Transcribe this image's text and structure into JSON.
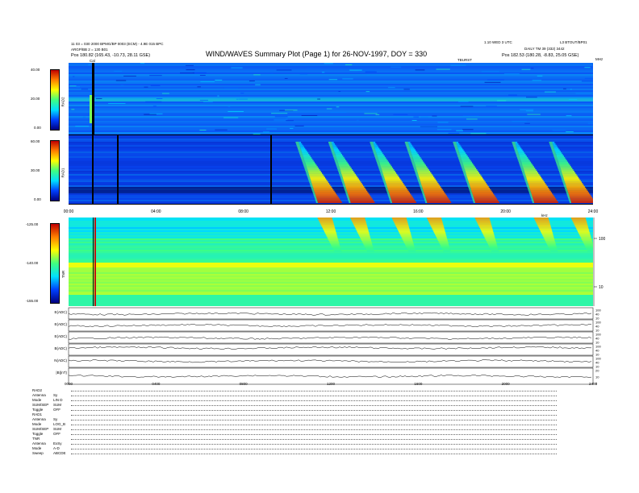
{
  "header": {
    "left_line1": "11 03 = 030 2000 BPMG/BP 0003 (ECM) - 4.9E 015 BPC",
    "left_line2": "ARGP/BB 2 = 130 B01",
    "left_pos": "Pos    180.82 (165.43, -10.73, 28.11 GSE)",
    "title": "WIND/WAVES Summary Plot (Page 1) for 26-NOV-1997, DOY = 330",
    "right_line1": "1.10 WED 3 UTC",
    "right_line2": "L3 BTOUT/BP01",
    "right_line3": "DAILY  TM 39 (332) 3442",
    "right_pos": "Pos    182.53 (180.28, -8.83, 25.05 GSE)",
    "top_right_tag": "TBURST",
    "cal_label": "Cal",
    "mhz_label": "MHz",
    "khz_label": "kHz"
  },
  "chart_data": [
    {
      "type": "heatmap",
      "panel": "RAD2",
      "ylabel": "RAD2",
      "colorbar_ticks": [
        "40.00",
        "20.00",
        "0.00"
      ],
      "colorbar_range": [
        0,
        40
      ],
      "colormap": [
        "#000080",
        "#0040ff",
        "#00e0ff",
        "#40ff80",
        "#ffff00",
        "#ff8000",
        "#c00000"
      ],
      "dominant_color": "#1050e8",
      "x_range_hours": [
        0,
        24
      ]
    },
    {
      "type": "heatmap",
      "panel": "RAD1",
      "ylabel": "RAD1",
      "colorbar_ticks": [
        "60.00",
        "30.00",
        "0.00"
      ],
      "colorbar_range": [
        0,
        60
      ],
      "x_ticks": [
        "00:00",
        "04:00",
        "08:00",
        "12:00",
        "16:00",
        "20:00",
        "24:00"
      ],
      "burst_start_hours": [
        11.4,
        12.9,
        14.8,
        16.4,
        18.6,
        21.3,
        23.0
      ],
      "dominant_color": "#1040e0",
      "x_range_hours": [
        0,
        24
      ]
    },
    {
      "type": "heatmap",
      "panel": "TNR",
      "ylabel": "TNR",
      "colorbar_ticks": [
        "-125.00",
        "-140.00",
        "-155.00"
      ],
      "colorbar_range": [
        -155,
        -125
      ],
      "right_axis_ticks": [
        "100",
        "10"
      ],
      "right_axis_scale": "log",
      "x_range_hours": [
        0,
        24
      ]
    },
    {
      "type": "line",
      "panel": "lines",
      "series": [
        {
          "name": "E(ADC)",
          "right_ticks": [
            "100",
            "40",
            "10"
          ],
          "level": 0.55
        },
        {
          "name": "E(ADC)",
          "right_ticks": [
            "100",
            "40",
            "10"
          ],
          "level": 0.5
        },
        {
          "name": "E(ADC)",
          "right_ticks": [
            "100",
            "40",
            "10"
          ],
          "level": 0.55
        },
        {
          "name": "B(ADC)",
          "right_ticks": [
            "100",
            "40",
            "10"
          ],
          "level": 0.35
        },
        {
          "name": "N(ADC)",
          "right_ticks": [
            "100",
            "40",
            "10"
          ],
          "level": 0.45
        },
        {
          "name": "|B|(nT)",
          "right_ticks": [
            "20",
            "10",
            "5"
          ],
          "level": 0.5
        }
      ],
      "x_ticks": [
        "0000",
        "0400",
        "0800",
        "1200",
        "1600",
        "2000",
        "2400"
      ],
      "x_range_hours": [
        0,
        24
      ]
    }
  ],
  "config": [
    {
      "label": "RAD2",
      "value": ""
    },
    {
      "label": "Antenna",
      "value": "Sy"
    },
    {
      "label": "Mode",
      "value": "LIN D"
    },
    {
      "label": "SUM/SEP",
      "value": "SUM"
    },
    {
      "label": "Toggle",
      "value": "OFF"
    },
    {
      "label": "RAD1",
      "value": ""
    },
    {
      "label": "Antenna",
      "value": "Sy"
    },
    {
      "label": "Mode",
      "value": "LOG_B"
    },
    {
      "label": "SUM/SEP",
      "value": "SUM"
    },
    {
      "label": "Toggle",
      "value": "OFF"
    },
    {
      "label": "TNR",
      "value": ""
    },
    {
      "label": "Antenna",
      "value": "ExSy"
    },
    {
      "label": "Mode",
      "value": "A-D"
    },
    {
      "label": "Sweep",
      "value": "ABCDE"
    }
  ]
}
